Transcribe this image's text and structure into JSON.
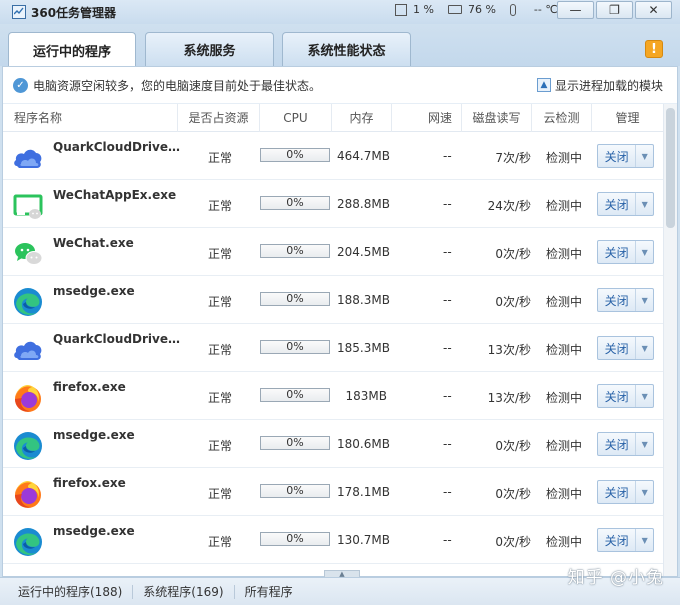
{
  "window": {
    "title": "360任务管理器"
  },
  "stats": {
    "cpu": "1 %",
    "memory": "76 %",
    "temp": "-- ℃"
  },
  "window_buttons": {
    "minimize": "—",
    "restore": "❐",
    "close": "✕"
  },
  "tabs": [
    {
      "label": "运行中的程序"
    },
    {
      "label": "系统服务"
    },
    {
      "label": "系统性能状态"
    }
  ],
  "warn_icon": "!",
  "notice": {
    "text": "电脑资源空闲较多，您的电脑速度目前处于最佳状态。",
    "link": "显示进程加载的模块"
  },
  "columns": [
    "程序名称",
    "是否占资源",
    "CPU",
    "内存",
    "网速",
    "磁盘读写",
    "云检测",
    "管理"
  ],
  "rows": [
    {
      "name": "QuarkCloudDrive.e...",
      "icon": "quark",
      "status": "正常",
      "cpu": "0%",
      "mem": "464.7MB",
      "net": "--",
      "disk": "7次/秒",
      "cloud": "检测中",
      "action": "关闭"
    },
    {
      "name": "WeChatAppEx.exe",
      "icon": "wechatappex",
      "status": "正常",
      "cpu": "0%",
      "mem": "288.8MB",
      "net": "--",
      "disk": "24次/秒",
      "cloud": "检测中",
      "action": "关闭"
    },
    {
      "name": "WeChat.exe",
      "icon": "wechat",
      "status": "正常",
      "cpu": "0%",
      "mem": "204.5MB",
      "net": "--",
      "disk": "0次/秒",
      "cloud": "检测中",
      "action": "关闭"
    },
    {
      "name": "msedge.exe",
      "icon": "edge",
      "status": "正常",
      "cpu": "0%",
      "mem": "188.3MB",
      "net": "--",
      "disk": "0次/秒",
      "cloud": "检测中",
      "action": "关闭"
    },
    {
      "name": "QuarkCloudDrive.e...",
      "icon": "quark",
      "status": "正常",
      "cpu": "0%",
      "mem": "185.3MB",
      "net": "--",
      "disk": "13次/秒",
      "cloud": "检测中",
      "action": "关闭"
    },
    {
      "name": "firefox.exe",
      "icon": "firefox",
      "status": "正常",
      "cpu": "0%",
      "mem": "183MB",
      "net": "--",
      "disk": "13次/秒",
      "cloud": "检测中",
      "action": "关闭"
    },
    {
      "name": "msedge.exe",
      "icon": "edge",
      "status": "正常",
      "cpu": "0%",
      "mem": "180.6MB",
      "net": "--",
      "disk": "0次/秒",
      "cloud": "检测中",
      "action": "关闭"
    },
    {
      "name": "firefox.exe",
      "icon": "firefox",
      "status": "正常",
      "cpu": "0%",
      "mem": "178.1MB",
      "net": "--",
      "disk": "0次/秒",
      "cloud": "检测中",
      "action": "关闭"
    },
    {
      "name": "msedge.exe",
      "icon": "edge",
      "status": "正常",
      "cpu": "0%",
      "mem": "130.7MB",
      "net": "--",
      "disk": "0次/秒",
      "cloud": "检测中",
      "action": "关闭"
    }
  ],
  "statusbar": {
    "running": "运行中的程序(188)",
    "system": "系统程序(169)",
    "all": "所有程序"
  },
  "watermark": "知乎 @小兔"
}
